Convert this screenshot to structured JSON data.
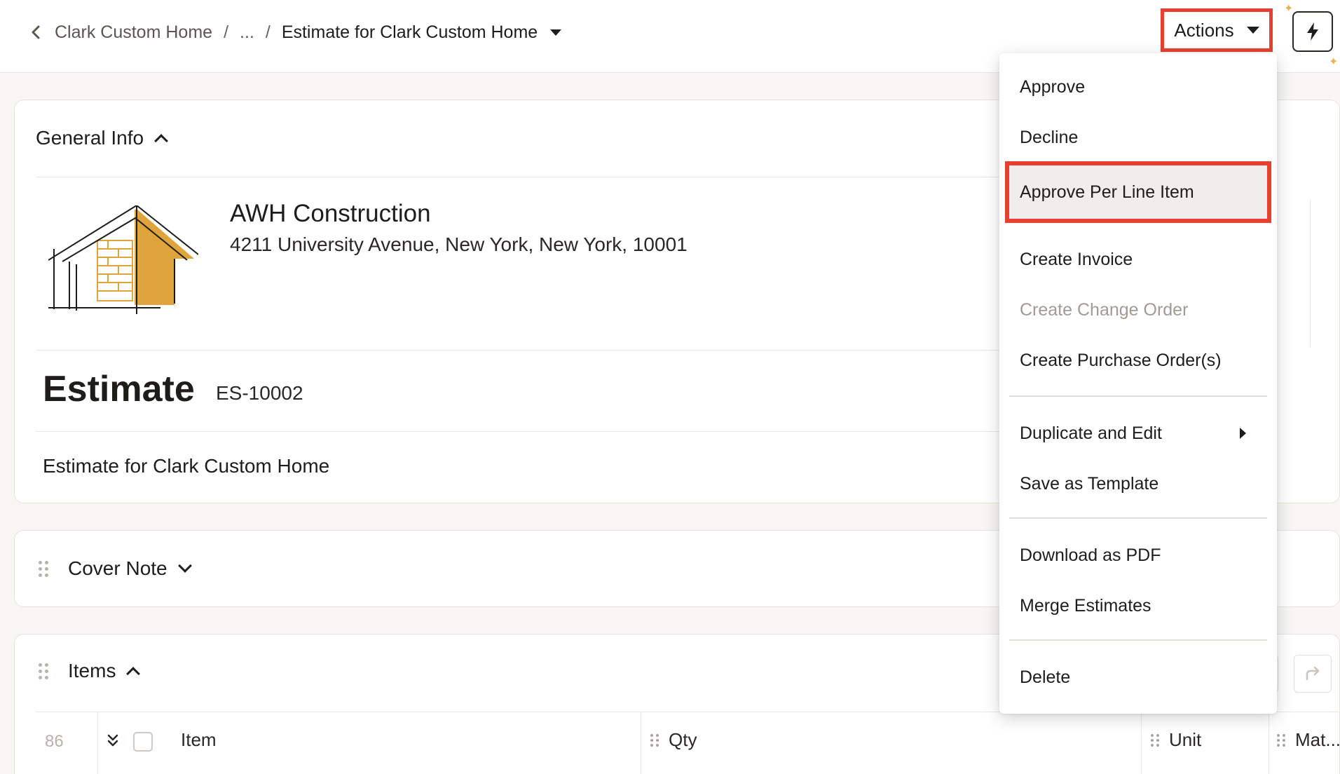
{
  "breadcrumb": {
    "parent": "Clark Custom Home",
    "ellipsis": "...",
    "separator": "/",
    "current": "Estimate for Clark Custom Home"
  },
  "header": {
    "actions_label": "Actions"
  },
  "general_info": {
    "title": "General Info",
    "company_name": "AWH Construction",
    "company_address": "4211 University Avenue, New York, New York, 10001",
    "doc_type": "Estimate",
    "doc_number": "ES-10002",
    "doc_title": "Estimate for Clark Custom Home"
  },
  "cover_note": {
    "title": "Cover Note"
  },
  "items": {
    "title": "Items",
    "row_count": "86",
    "columns": [
      "Item",
      "Qty",
      "Unit",
      "Mat..."
    ]
  },
  "actions_menu": {
    "items": [
      {
        "label": "Approve",
        "disabled": false
      },
      {
        "label": "Decline",
        "disabled": false
      },
      {
        "label": "Approve Per Line Item",
        "disabled": false,
        "highlighted": true
      },
      {
        "label": "Create Invoice",
        "disabled": false
      },
      {
        "label": "Create Change Order",
        "disabled": true
      },
      {
        "label": "Create Purchase Order(s)",
        "disabled": false
      },
      {
        "label": "Duplicate and Edit",
        "disabled": false,
        "submenu": true
      },
      {
        "label": "Save as Template",
        "disabled": false
      },
      {
        "label": "Download as PDF",
        "disabled": false
      },
      {
        "label": "Merge Estimates",
        "disabled": false
      },
      {
        "label": "Delete",
        "disabled": false
      }
    ]
  },
  "colors": {
    "highlight_border": "#e8402f",
    "logo_gold": "#dfa53c",
    "background": "#f7f6f3"
  },
  "icons": [
    "chevron-left-icon",
    "caret-down-icon",
    "bolt-icon",
    "sparkle-icon",
    "chevron-up-icon",
    "chevron-down-icon",
    "drag-handle-icon",
    "expand-all-icon",
    "redo-icon",
    "caret-right-icon"
  ]
}
